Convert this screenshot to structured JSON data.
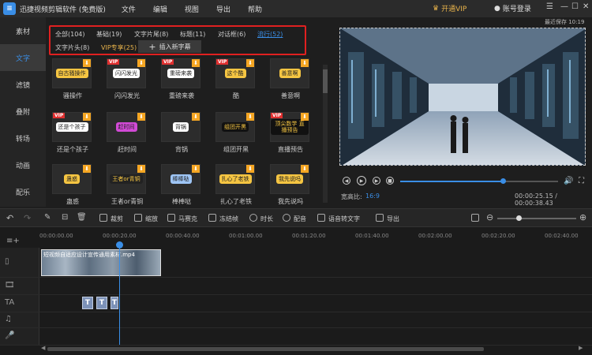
{
  "app": {
    "title": "迅捷视频剪辑软件 (免费版)",
    "menu": [
      "文件",
      "编辑",
      "视图",
      "导出",
      "帮助"
    ],
    "vip_label": "开通VIP",
    "login_label": "账号登录"
  },
  "sidebar": {
    "items": [
      {
        "label": "素材"
      },
      {
        "label": "文字"
      },
      {
        "label": "滤镜"
      },
      {
        "label": "叠附"
      },
      {
        "label": "转场"
      },
      {
        "label": "动画"
      },
      {
        "label": "配乐"
      }
    ],
    "active_index": 1
  },
  "text_tabs": {
    "row1": [
      "全部(104)",
      "基础(19)",
      "文字片尾(8)",
      "标题(11)",
      "对话框(6)",
      "流行(52)"
    ],
    "row2": [
      "文字片头(8)",
      "VIP专享(25)"
    ],
    "active": "流行(52)",
    "insert_label": "插入新字幕"
  },
  "templates": [
    {
      "caption": "骚操作",
      "art": "自古骚操作",
      "vip": false,
      "color": "#f5c542"
    },
    {
      "caption": "闪闪发光",
      "art": "闪闪发光",
      "vip": true,
      "color": "#ffffff"
    },
    {
      "caption": "重磅来袭",
      "art": "重磅来袭",
      "vip": true,
      "color": "#ffffff"
    },
    {
      "caption": "酷",
      "art": "这个酷",
      "vip": true,
      "color": "#f5c542"
    },
    {
      "caption": "善意啊",
      "art": "善意啊",
      "vip": false,
      "color": "#f5c542"
    },
    {
      "caption": "还是个孩子",
      "art": "还是个孩子",
      "vip": true,
      "color": "#ffffff"
    },
    {
      "caption": "赶时间",
      "art": "赶时间",
      "vip": false,
      "color": "#d24ad6"
    },
    {
      "caption": "背锅",
      "art": "背锅",
      "vip": false,
      "color": "#ffffff"
    },
    {
      "caption": "组团开黑",
      "art": "组团开黑",
      "vip": false,
      "color": "#111111"
    },
    {
      "caption": "直播预告",
      "art": "顶尖数学 直播预告",
      "vip": true,
      "color": "#111111"
    },
    {
      "caption": "蛊惑",
      "art": "蛊惑",
      "vip": false,
      "color": "#f5c542"
    },
    {
      "caption": "王者or青铜",
      "art": "王者or青铜",
      "vip": false,
      "color": "#222222"
    },
    {
      "caption": "棒棒哒",
      "art": "棒棒哒",
      "vip": false,
      "color": "#9ec5f5"
    },
    {
      "caption": "扎心了老铁",
      "art": "扎心了老铁",
      "vip": false,
      "color": "#f5c542"
    },
    {
      "caption": "我先说吗",
      "art": "我先说吗",
      "vip": false,
      "color": "#f5c542"
    }
  ],
  "preview": {
    "autosave": "最近保存 10:19",
    "aspect_label": "宽高比:",
    "aspect_value": "16:9",
    "time": "00:00:25.15 / 00:00:38.43",
    "progress": 0.65
  },
  "toolbar": {
    "tools": [
      "裁剪",
      "缩放",
      "马赛克",
      "冻结帧",
      "时长",
      "配音",
      "语音转文字",
      "导出"
    ]
  },
  "timeline": {
    "ticks": [
      "00:00:00.00",
      "00:00:20.00",
      "00:00:40.00",
      "00:01:00.00",
      "00:01:20.00",
      "00:01:40.00",
      "00:02:00.00",
      "00:02:20.00",
      "00:02:40.00"
    ],
    "clip_title": "短视频自适应设计宣传通用素材.mp4",
    "text_clip_label": "T"
  }
}
